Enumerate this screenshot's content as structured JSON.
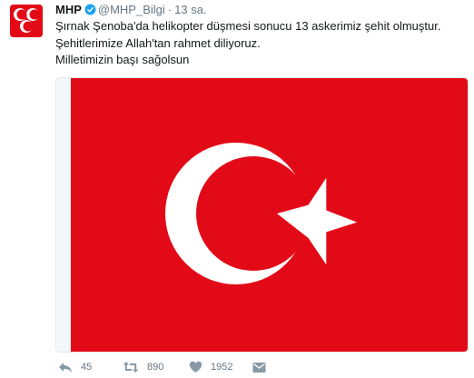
{
  "tweet": {
    "author_name": "MHP",
    "author_handle": "@MHP_Bilgi",
    "separator": "·",
    "timestamp": "13 sa.",
    "text_lines": [
      "Şırnak Şenoba'da helikopter düşmesi sonucu 13 askerimiz şehit olmuştur.",
      "Şehitlerimize Allah'tan rahmet diliyoruz.",
      "Milletimizin başı sağolsun"
    ],
    "media": {
      "description_icon": "turkish-flag-image"
    }
  },
  "actions": {
    "reply": {
      "icon": "reply-icon",
      "count": "45"
    },
    "retweet": {
      "icon": "retweet-icon",
      "count": "890"
    },
    "like": {
      "icon": "heart-icon",
      "count": "1952"
    },
    "message": {
      "icon": "direct-message-icon"
    }
  },
  "colors": {
    "flag_red": "#e30a17",
    "verified_blue": "#1da1f2",
    "muted_text": "#657786"
  }
}
